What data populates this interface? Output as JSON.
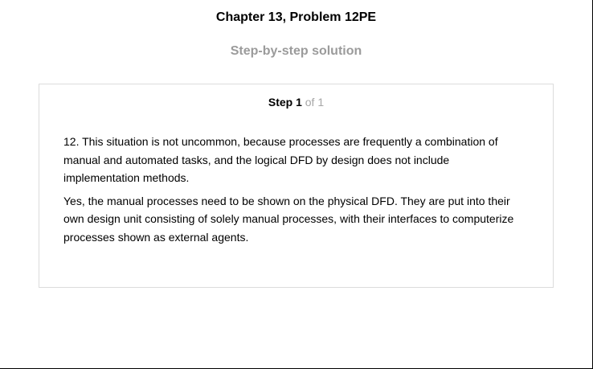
{
  "header": {
    "title": "Chapter 13, Problem 12PE",
    "subtitle": "Step-by-step solution"
  },
  "step": {
    "label": "Step 1",
    "count": "of 1",
    "paragraphs": [
      "12. This situation is not uncommon, because processes are frequently a combination of manual and automated tasks, and the logical DFD by design does not include implementation methods.",
      "Yes, the manual processes need to be shown on the physical DFD. They are put into their own design unit consisting of solely manual processes, with their interfaces to computerize processes shown as external agents."
    ]
  }
}
